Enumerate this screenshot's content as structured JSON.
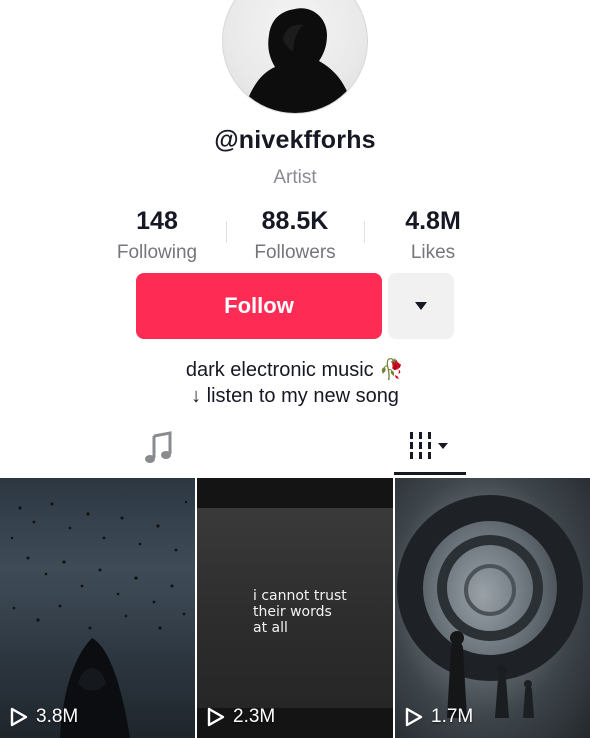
{
  "profile": {
    "username": "@nivekfforhs",
    "category": "Artist",
    "avatar_icon": "hooded-figure"
  },
  "stats": {
    "following": {
      "value": "148",
      "label": "Following"
    },
    "followers": {
      "value": "88.5K",
      "label": "Followers"
    },
    "likes": {
      "value": "4.8M",
      "label": "Likes"
    }
  },
  "actions": {
    "follow_label": "Follow",
    "follow_color": "#fe2c55",
    "more_icon": "caret-down-icon"
  },
  "bio": {
    "line1": "dark electronic music 🥀",
    "line2": "↓ listen to my new song"
  },
  "tabs": {
    "music_icon": "music-note-icon",
    "videos_icon": "grid-icon",
    "active": "videos"
  },
  "videos": [
    {
      "views": "3.8M",
      "caption": ""
    },
    {
      "views": "2.3M",
      "caption": "i cannot trust\ntheir words\nat all"
    },
    {
      "views": "1.7M",
      "caption": ""
    }
  ]
}
